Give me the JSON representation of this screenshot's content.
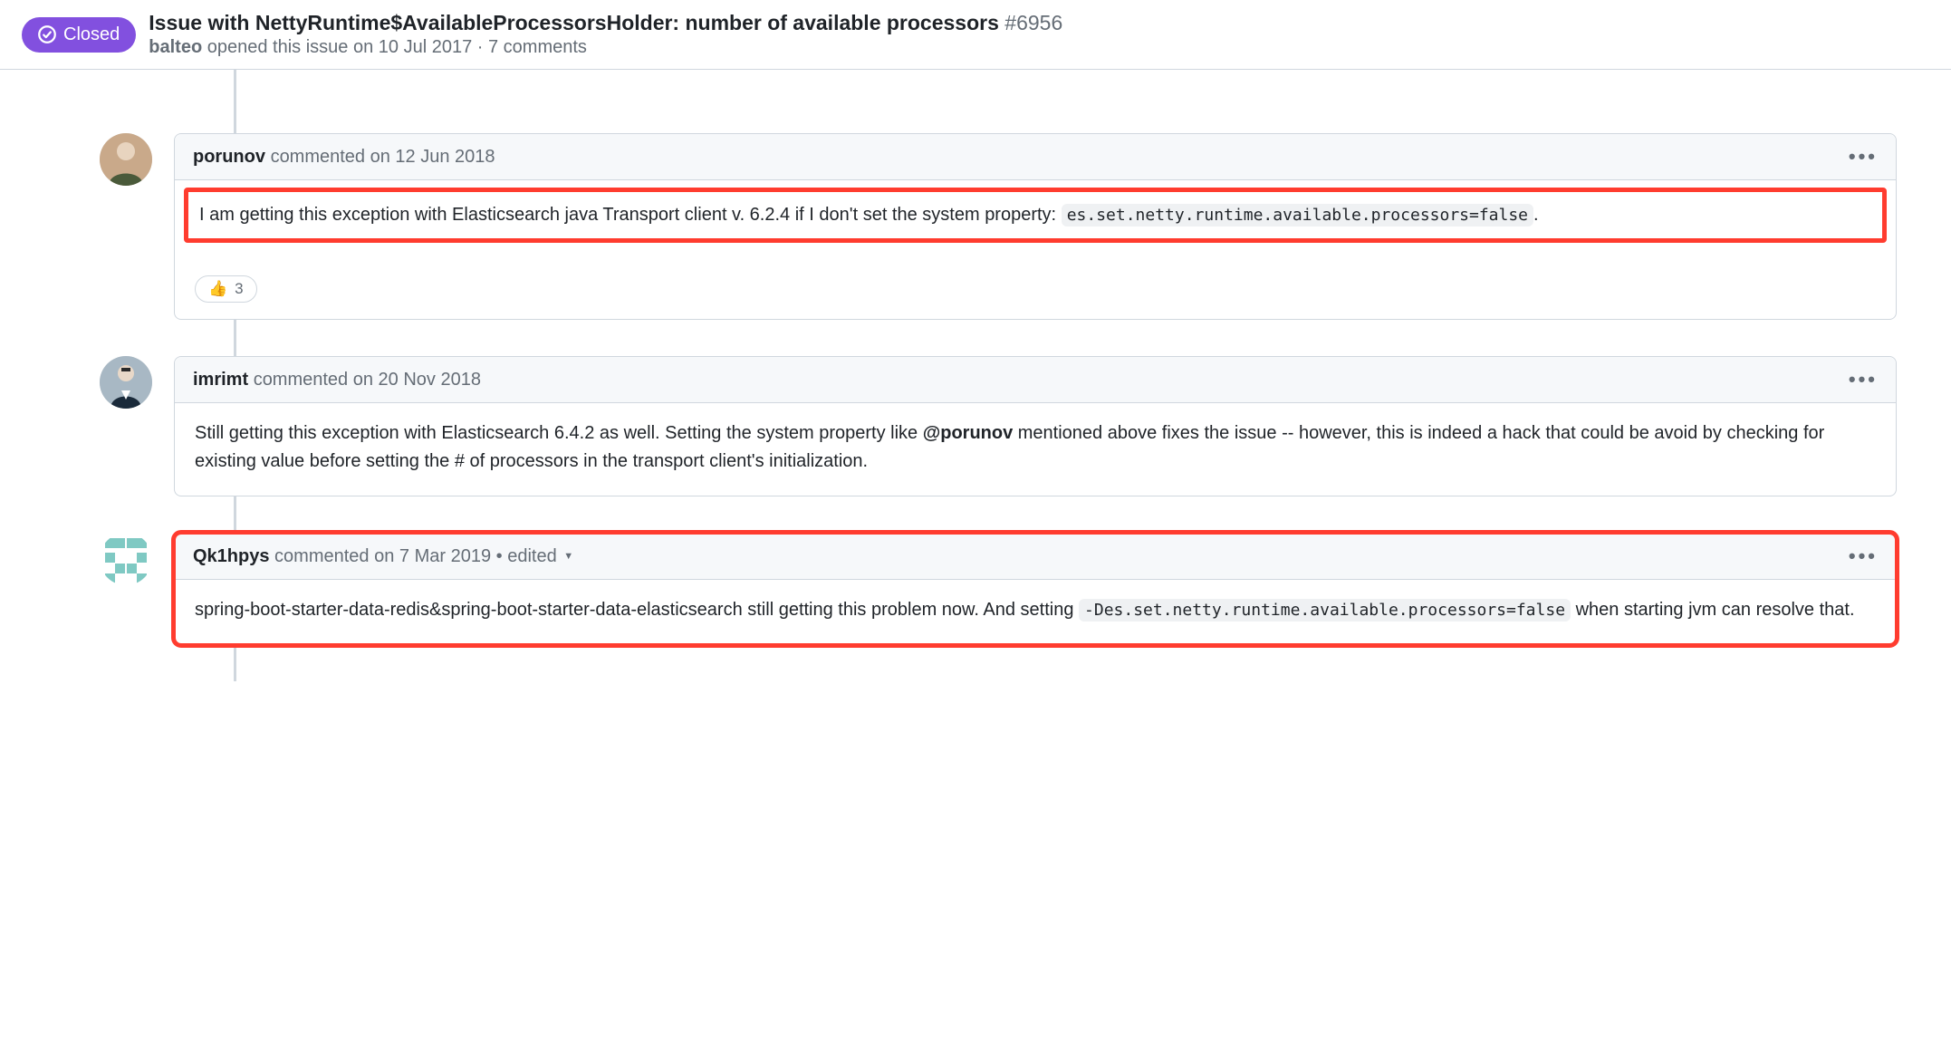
{
  "header": {
    "closed_label": "Closed",
    "title": "Issue with NettyRuntime$AvailableProcessorsHolder: number of available processors",
    "issue_number": "#6956",
    "author": "balteo",
    "opened_text": "opened this issue",
    "opened_date": "on 10 Jul 2017",
    "dot": "·",
    "comment_count": "7 comments"
  },
  "comments": [
    {
      "user": "porunov",
      "action": "commented",
      "date": "on 12 Jun 2018",
      "body_pre": "I am getting this exception with Elasticsearch java Transport client v. 6.2.4 if I don't set the system property:",
      "code": "es.set.netty.runtime.available.processors=false",
      "body_post": ".",
      "reaction_emoji": "👍",
      "reaction_count": "3"
    },
    {
      "user": "imrimt",
      "action": "commented",
      "date": "on 20 Nov 2018",
      "body_pre": "Still getting this exception with Elasticsearch 6.4.2 as well. Setting the system property like ",
      "mention": "@porunov",
      "body_post": " mentioned above fixes the issue -- however, this is indeed a hack that could be avoid by checking for existing value before setting the # of processors in the transport client's initialization."
    },
    {
      "user": "Qk1hpys",
      "action": "commented",
      "date": "on 7 Mar 2019",
      "edited": "• edited",
      "body_pre": "spring-boot-starter-data-redis&spring-boot-starter-data-elasticsearch still getting this problem now. And setting ",
      "code": "-Des.set.netty.runtime.available.processors=false",
      "body_post": " when starting jvm can resolve that."
    }
  ]
}
